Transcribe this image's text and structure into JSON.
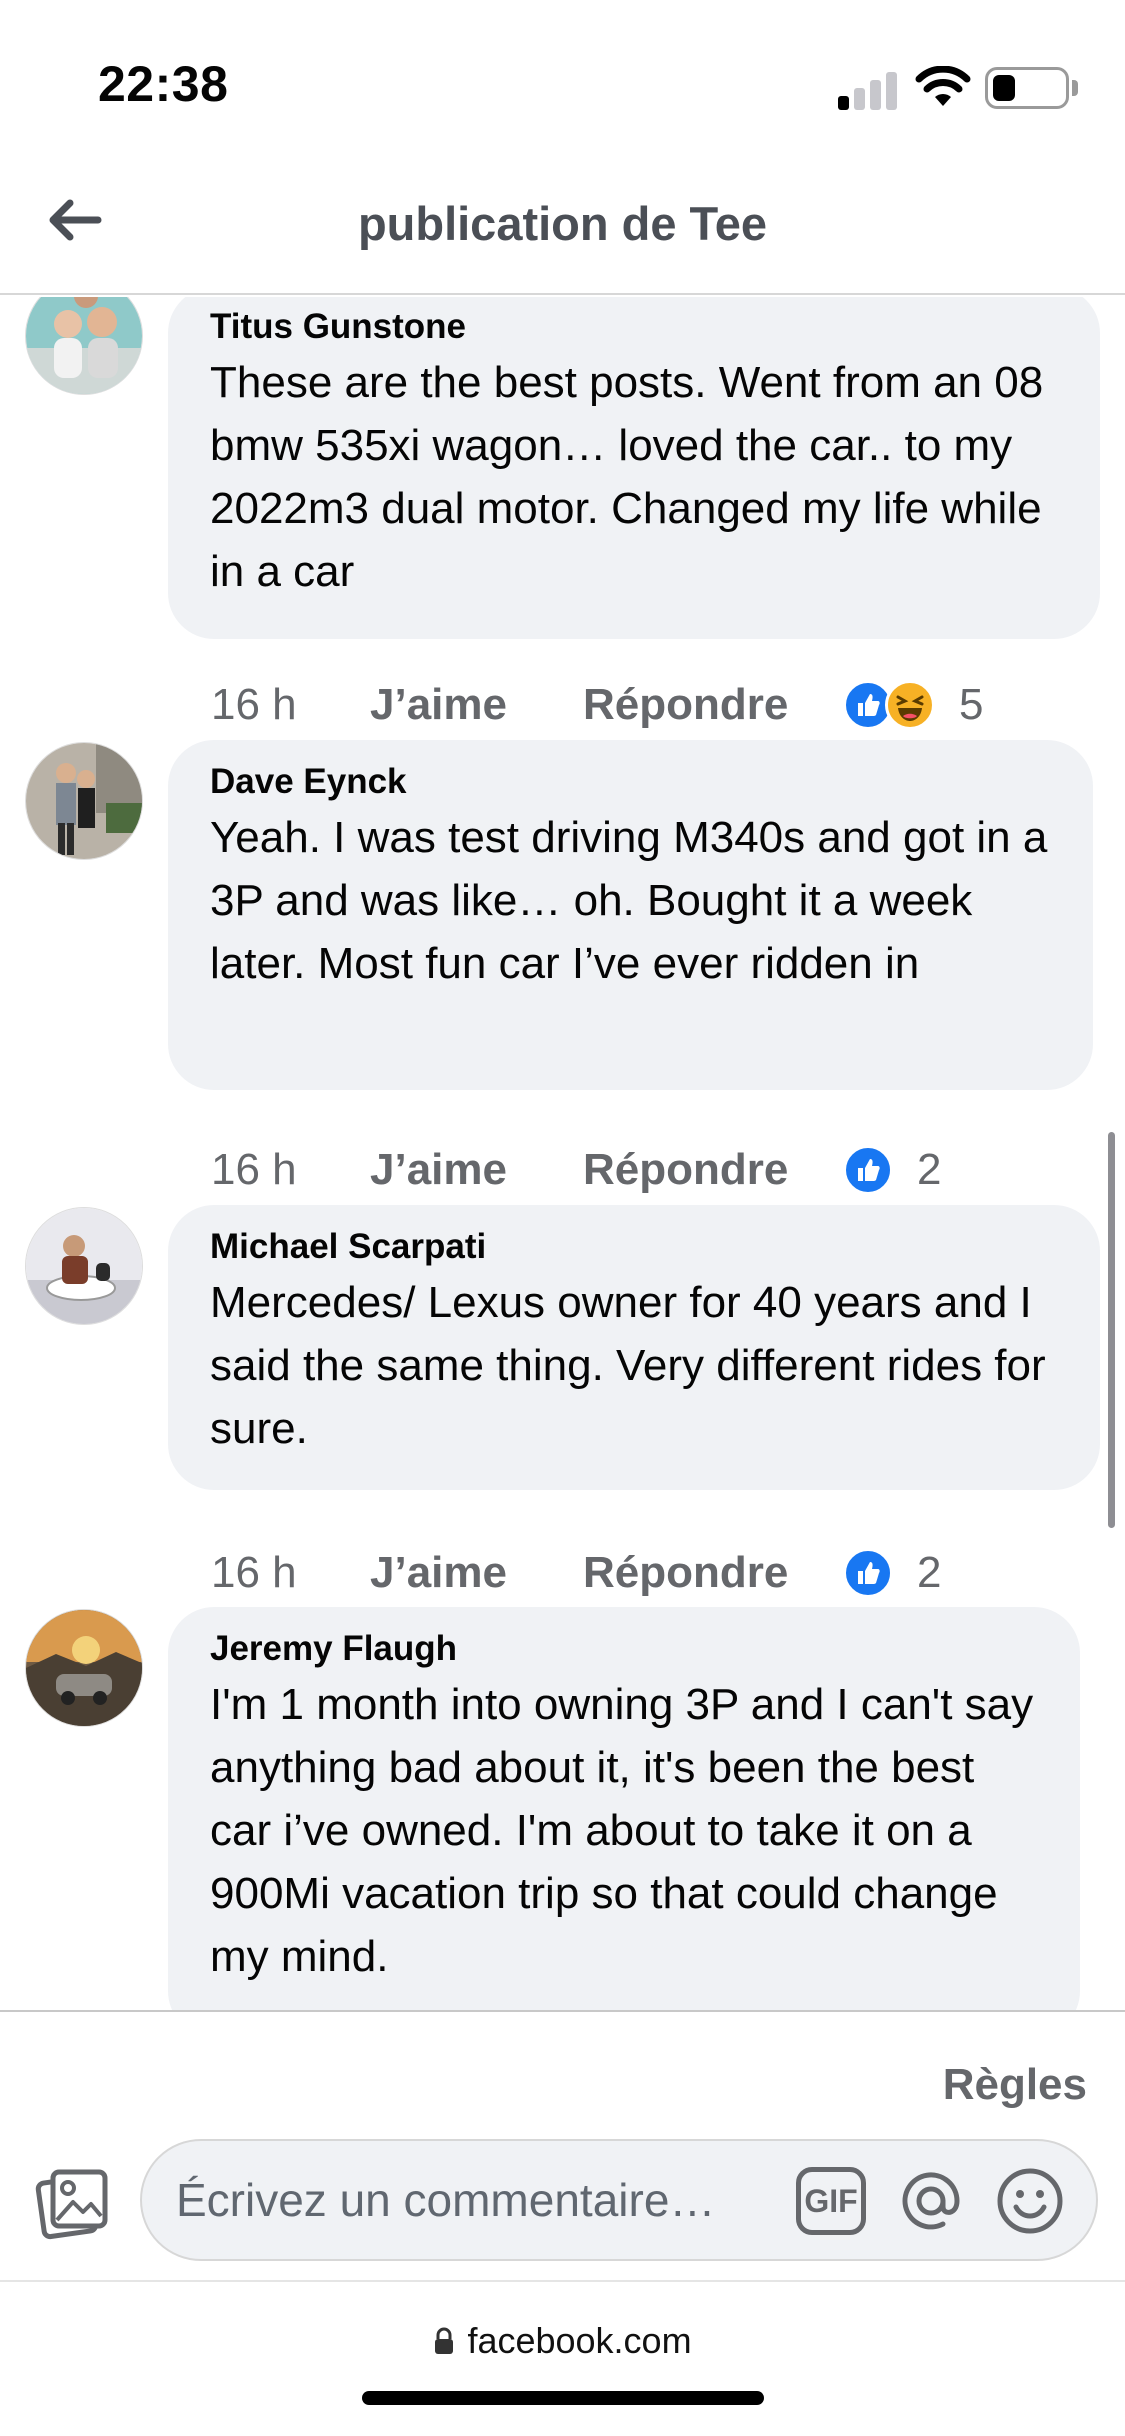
{
  "status_bar": {
    "time": "22:38",
    "signal_bars_on": 1,
    "signal_bars_total": 4,
    "battery_level": 0.25
  },
  "header": {
    "title": "publication de Tee",
    "back_icon": "arrow-left-icon"
  },
  "comments": [
    {
      "author": "Titus Gunstone",
      "text": "These are the best posts. Went from an 08 bmw 535xi wagon… loved the car.. to my 2022m3 dual motor. Changed my life while in a car",
      "time": "16 h",
      "like_label": "J’aime",
      "reply_label": "Répondre",
      "reactions": [
        "like",
        "haha"
      ],
      "reaction_count": "5"
    },
    {
      "author": "Dave Eynck",
      "text": "Yeah. I was test driving M340s and got in a 3P and was like… oh. Bought it a week later. Most fun car I’ve ever ridden in",
      "time": "16 h",
      "like_label": "J’aime",
      "reply_label": "Répondre",
      "reactions": [
        "like"
      ],
      "reaction_count": "2"
    },
    {
      "author": "Michael Scarpati",
      "text": "Mercedes/ Lexus owner for 40 years and I said the same thing. Very different rides for sure.",
      "time": "16 h",
      "like_label": "J’aime",
      "reply_label": "Répondre",
      "reactions": [
        "like"
      ],
      "reaction_count": "2"
    },
    {
      "author": "Jeremy Flaugh",
      "text": "I'm 1 month into owning 3P and I can't say anything bad about it, it's been the best car i’ve owned. I'm about to take it on a 900Mi vacation trip so that could change my mind."
    }
  ],
  "composer": {
    "rules_label": "Règles",
    "placeholder": "Écrivez un commentaire…",
    "gif_label": "GIF"
  },
  "browser": {
    "url": "facebook.com"
  },
  "colors": {
    "bubble": "#f0f2f5",
    "secondary_text": "#65676b",
    "like_blue": "#1877f2",
    "haha_yellow": "#f7b125"
  }
}
